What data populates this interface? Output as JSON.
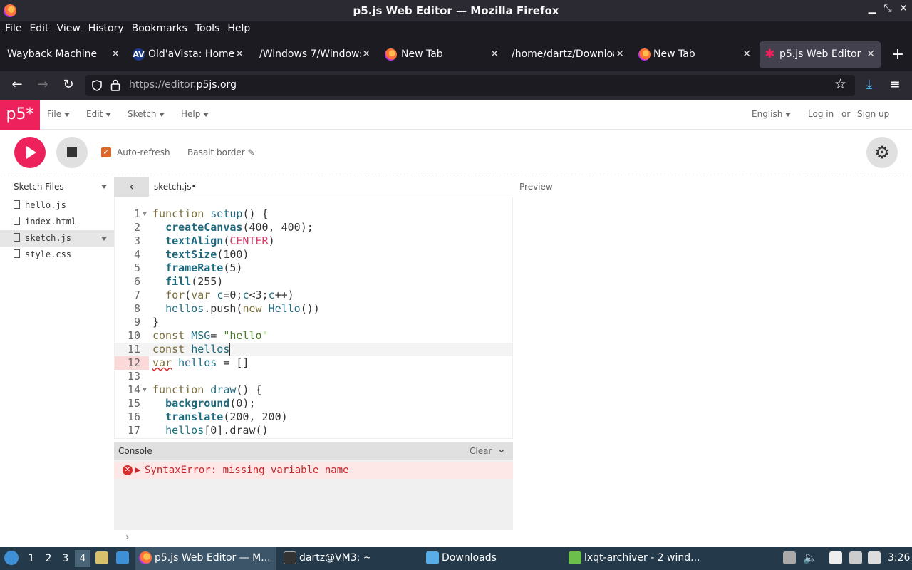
{
  "window": {
    "title": "p5.js Web Editor — Mozilla Firefox"
  },
  "menubar": [
    "File",
    "Edit",
    "View",
    "History",
    "Bookmarks",
    "Tools",
    "Help"
  ],
  "tabs": [
    {
      "label": "Wayback Machine"
    },
    {
      "label": "Old'aVista: Home",
      "icon_text": "AV"
    },
    {
      "label": "/Windows 7/Windows"
    },
    {
      "label": "New Tab"
    },
    {
      "label": "/home/dartz/Downloa"
    },
    {
      "label": "New Tab"
    },
    {
      "label": "p5.js Web Editor",
      "active": true
    }
  ],
  "url": {
    "prefix": "https://editor.",
    "domain": "p5js.org"
  },
  "p5": {
    "logo": "p5*",
    "menu": [
      "File",
      "Edit",
      "Sketch",
      "Help"
    ],
    "language": "English",
    "login": "Log in",
    "or": "or",
    "signup": "Sign up",
    "auto_refresh": "Auto-refresh",
    "sketch_name": "Basalt border",
    "sidebar_title": "Sketch Files",
    "files": [
      "hello.js",
      "index.html",
      "sketch.js",
      "style.css"
    ],
    "selected_file": "sketch.js",
    "open_tab": "sketch.js",
    "preview_label": "Preview",
    "console_title": "Console",
    "console_clear": "Clear",
    "console_error": "SyntaxError: missing variable name"
  },
  "code_lines": [
    "1",
    "2",
    "3",
    "4",
    "5",
    "6",
    "7",
    "8",
    "9",
    "10",
    "11",
    "12",
    "13",
    "14",
    "15",
    "16",
    "17"
  ],
  "taskbar": {
    "desktops": [
      "1",
      "2",
      "3",
      "4"
    ],
    "active_desktop": "4",
    "windows": [
      "p5.js Web Editor — M...",
      "dartz@VM3: ~",
      "Downloads",
      "lxqt-archiver - 2 wind..."
    ],
    "clock": "3:26"
  },
  "colors": {
    "p5_pink": "#ed225d",
    "firefox_dark": "#1c1b22",
    "taskbar": "#243a4b"
  }
}
